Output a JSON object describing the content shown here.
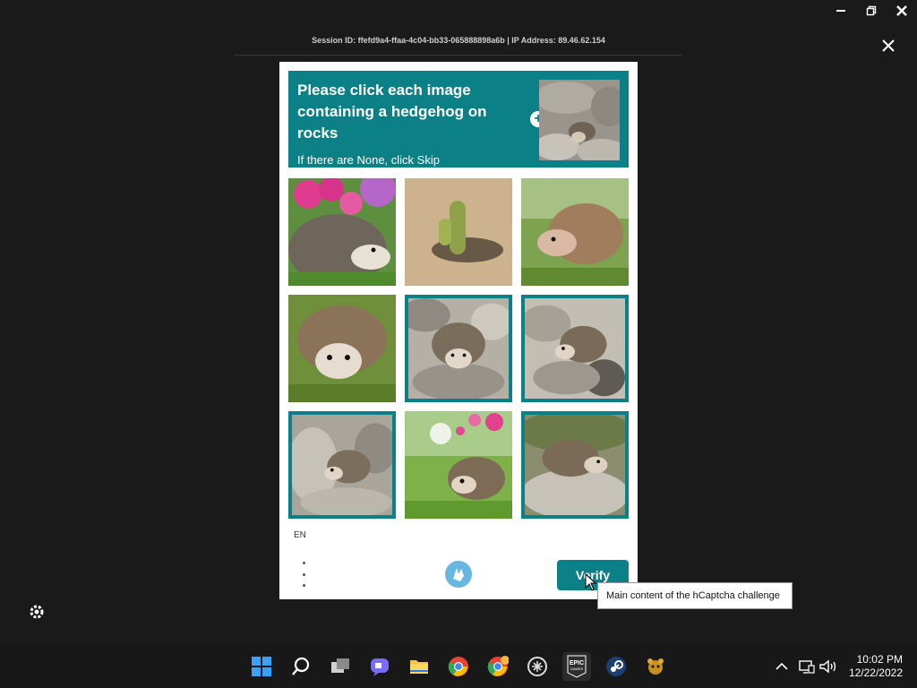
{
  "session_bar": {
    "text": "Session ID: ffefd9a4-ffaa-4c04-bb33-065888898a6b | IP Address: 89.46.62.154"
  },
  "challenge": {
    "prompt": "Please click each image containing a hedgehog on rocks",
    "subtext": "If there are None, click Skip",
    "example_label": "example image: hedgehog on rocks",
    "tiles": [
      {
        "subject": "hedgehog with pink flowers",
        "selected": false
      },
      {
        "subject": "cactus on sand",
        "selected": false
      },
      {
        "subject": "hedgehog on grass",
        "selected": false
      },
      {
        "subject": "hedgehog on grass",
        "selected": false
      },
      {
        "subject": "hedgehog on rocks",
        "selected": true
      },
      {
        "subject": "hedgehog on rocks",
        "selected": true
      },
      {
        "subject": "hedgehog on rocks",
        "selected": true
      },
      {
        "subject": "hedgehog in grass with flowers",
        "selected": false
      },
      {
        "subject": "hedgehog on rocks",
        "selected": true
      }
    ],
    "language": "EN",
    "verify_label": "Verify",
    "accent_color": "#0c8087"
  },
  "tooltip": {
    "text": "Main content of the hCaptcha challenge"
  },
  "taskbar": {
    "apps": [
      "windows-start-icon",
      "search-icon",
      "task-view-icon",
      "teams-chat-icon",
      "file-explorer-icon",
      "chrome-icon",
      "chrome-profile-icon",
      "unknown-app-icon",
      "epic-games-icon",
      "steam-icon",
      "game-app-icon"
    ],
    "epic_label": "EPIC",
    "epic_sublabel": "GAMES",
    "clock_time": "10:02 PM",
    "clock_date": "12/22/2022"
  }
}
